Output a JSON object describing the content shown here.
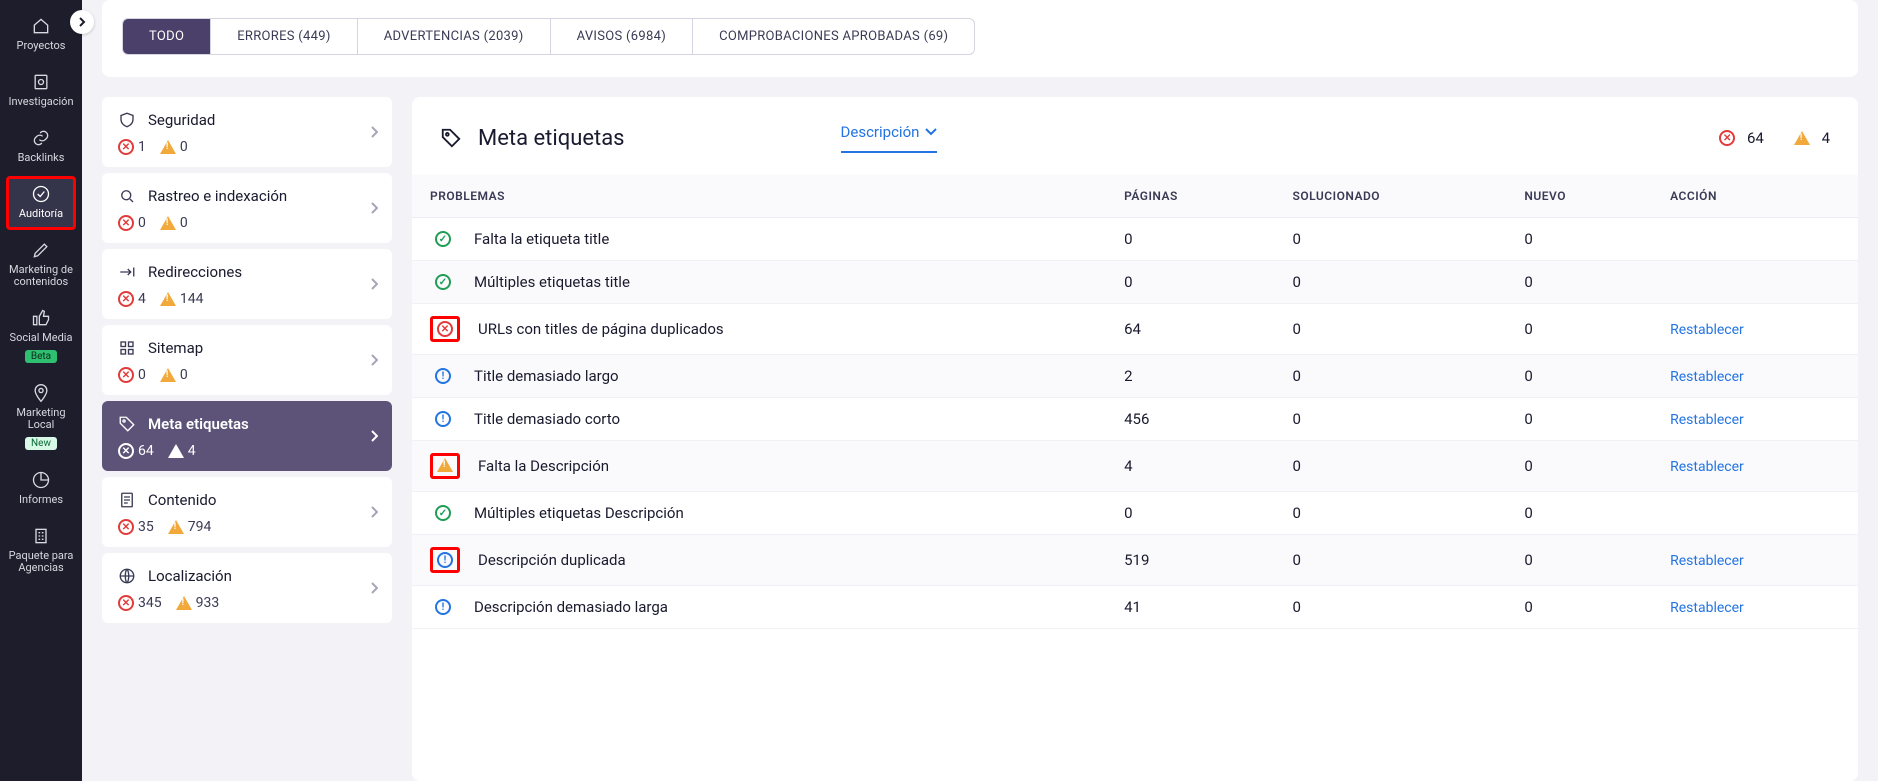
{
  "leftnav": {
    "items": [
      {
        "label": "Proyectos",
        "icon": "home"
      },
      {
        "label": "Investigación",
        "icon": "search-doc"
      },
      {
        "label": "Backlinks",
        "icon": "link"
      },
      {
        "label": "Auditoría",
        "icon": "check-circle",
        "active": true,
        "highlight": true
      },
      {
        "label": "Marketing de contenidos",
        "icon": "pencil"
      },
      {
        "label": "Social Media",
        "icon": "thumbs-up",
        "badge": "Beta",
        "badge_style": "beta"
      },
      {
        "label": "Marketing Local",
        "icon": "pin",
        "badge": "New",
        "badge_style": "new"
      },
      {
        "label": "Informes",
        "icon": "pie"
      },
      {
        "label": "Paquete para Agencias",
        "icon": "building"
      }
    ]
  },
  "tabs": [
    {
      "label": "TODO",
      "active": true
    },
    {
      "label": "ERRORES (449)"
    },
    {
      "label": "ADVERTENCIAS (2039)"
    },
    {
      "label": "AVISOS (6984)"
    },
    {
      "label": "COMPROBACIONES APROBADAS (69)"
    }
  ],
  "categories": [
    {
      "icon": "shield",
      "title": "Seguridad",
      "err": "1",
      "warn": "0"
    },
    {
      "icon": "search",
      "title": "Rastreo e indexación",
      "err": "0",
      "warn": "0"
    },
    {
      "icon": "redirect",
      "title": "Redirecciones",
      "err": "4",
      "warn": "144"
    },
    {
      "icon": "grid",
      "title": "Sitemap",
      "err": "0",
      "warn": "0"
    },
    {
      "icon": "tag",
      "title": "Meta etiquetas",
      "err": "64",
      "warn": "4",
      "active": true
    },
    {
      "icon": "doc",
      "title": "Contenido",
      "err": "35",
      "warn": "794"
    },
    {
      "icon": "globe",
      "title": "Localización",
      "err": "345",
      "warn": "933"
    }
  ],
  "panel": {
    "title": "Meta etiquetas",
    "filter_label": "Descripción",
    "summary_err": "64",
    "summary_warn": "4",
    "columns": [
      "PROBLEMAS",
      "PÁGINAS",
      "SOLUCIONADO",
      "NUEVO",
      "ACCIÓN"
    ],
    "action_label": "Restablecer",
    "rows": [
      {
        "status": "ok",
        "problem": "Falta la etiqueta title",
        "pages": "0",
        "solved": "0",
        "new": "0",
        "action": false
      },
      {
        "status": "ok",
        "problem": "Múltiples etiquetas title",
        "pages": "0",
        "solved": "0",
        "new": "0",
        "action": false
      },
      {
        "status": "err",
        "problem": "URLs con titles de página duplicados",
        "pages": "64",
        "solved": "0",
        "new": "0",
        "action": true,
        "highlight": true
      },
      {
        "status": "info",
        "problem": "Title demasiado largo",
        "pages": "2",
        "solved": "0",
        "new": "0",
        "action": true
      },
      {
        "status": "info",
        "problem": "Title demasiado corto",
        "pages": "456",
        "solved": "0",
        "new": "0",
        "action": true
      },
      {
        "status": "warn",
        "problem": "Falta la Descripción",
        "pages": "4",
        "solved": "0",
        "new": "0",
        "action": true,
        "highlight": true
      },
      {
        "status": "ok",
        "problem": "Múltiples etiquetas Descripción",
        "pages": "0",
        "solved": "0",
        "new": "0",
        "action": false
      },
      {
        "status": "info",
        "problem": "Descripción duplicada",
        "pages": "519",
        "solved": "0",
        "new": "0",
        "action": true,
        "highlight": true
      },
      {
        "status": "info",
        "problem": "Descripción demasiado larga",
        "pages": "41",
        "solved": "0",
        "new": "0",
        "action": true
      }
    ]
  }
}
